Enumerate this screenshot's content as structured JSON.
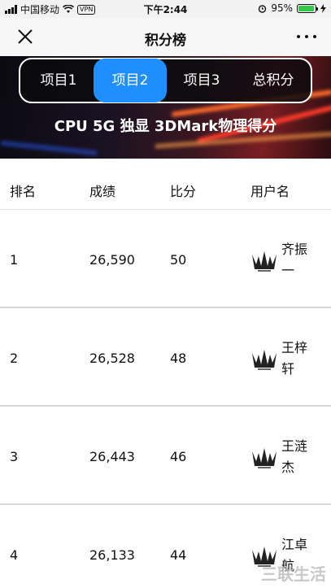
{
  "status_bar": {
    "carrier": "中国移动",
    "vpn": "VPN",
    "time": "下午2:44",
    "battery": "95%",
    "battery_level": 0.95
  },
  "nav": {
    "title": "积分榜"
  },
  "tabs": [
    "项目1",
    "项目2",
    "项目3",
    "总积分"
  ],
  "active_tab": 1,
  "banner": {
    "title": "CPU 5G 独显 3DMark物理得分"
  },
  "table": {
    "headers": [
      "排名",
      "成绩",
      "比分",
      "用户名"
    ],
    "rows": [
      {
        "rank": "1",
        "score": "26,590",
        "points": "50",
        "user": "齐振一"
      },
      {
        "rank": "2",
        "score": "26,528",
        "points": "48",
        "user": "王梓轩"
      },
      {
        "rank": "3",
        "score": "26,443",
        "points": "46",
        "user": "王涟杰"
      },
      {
        "rank": "4",
        "score": "26,133",
        "points": "44",
        "user": "江卓航"
      }
    ]
  },
  "colors": {
    "accent": "#1f8fff",
    "battery": "#32c94a"
  },
  "watermark": "三联生活"
}
